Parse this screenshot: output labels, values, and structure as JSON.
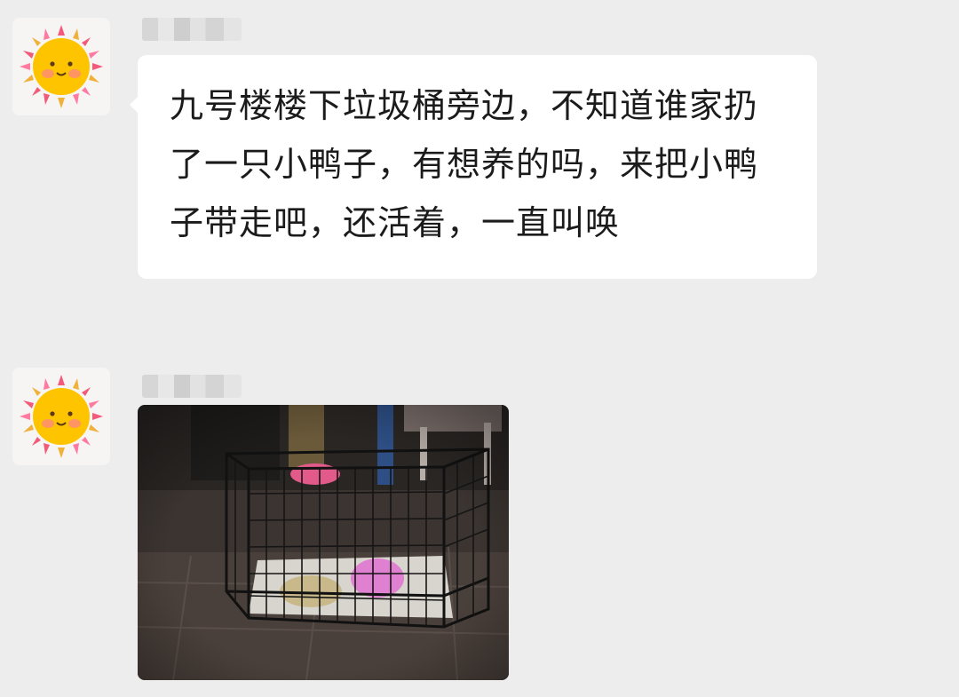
{
  "chat": {
    "messages": [
      {
        "type": "text",
        "sender_avatar": "sun-avatar-icon",
        "sender_name": "",
        "text": "九号楼楼下垃圾桶旁边，不知道谁家扔了一只小鸭子，有想养的吗，来把小鸭子带走吧，还活着，一直叫唤"
      },
      {
        "type": "image",
        "sender_avatar": "sun-avatar-icon",
        "sender_name": "",
        "image_subject": "dog-crate-photo"
      }
    ]
  },
  "colors": {
    "background": "#ededed",
    "bubble": "#ffffff",
    "text": "#1b1b1b",
    "sun": "#ffc400",
    "cheek": "#ff8a7a"
  }
}
